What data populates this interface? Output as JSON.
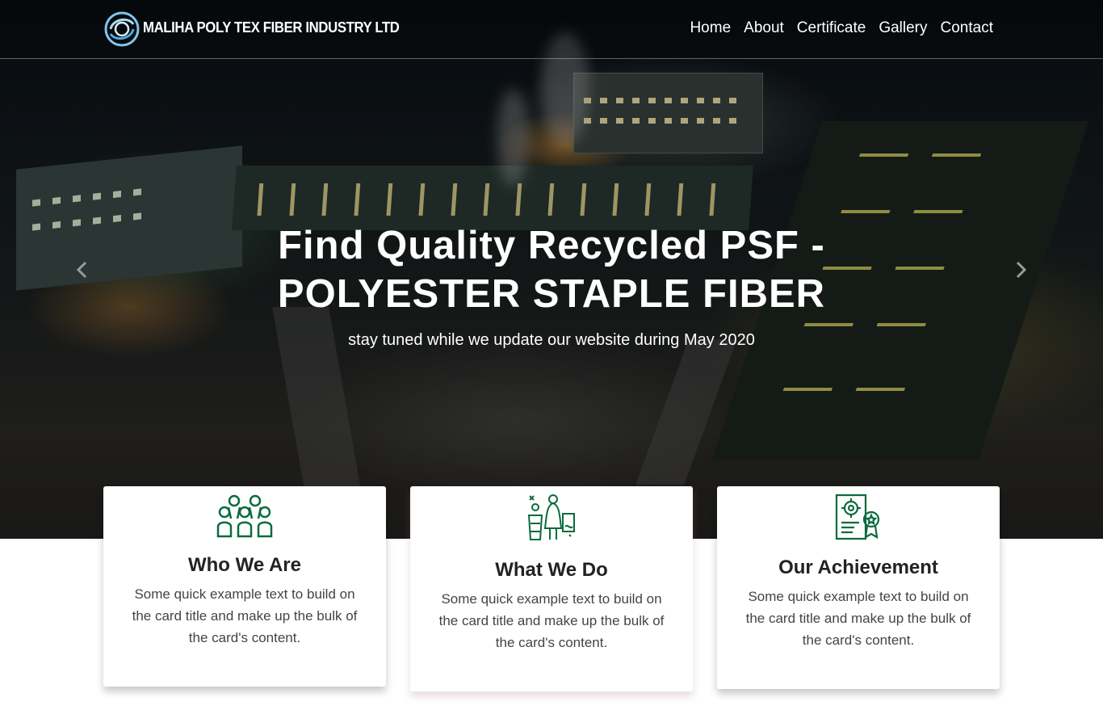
{
  "brand": {
    "name": "MALIHA POLY TEX FIBER INDUSTRY LTD",
    "logo_icon": "swirl-logo-icon"
  },
  "nav": {
    "items": [
      "Home",
      "About",
      "Certificate",
      "Gallery",
      "Contact"
    ]
  },
  "hero": {
    "title": "Find Quality Recycled PSF - POLYESTER STAPLE FIBER",
    "subtitle": "stay tuned while we update our website during May 2020",
    "prev_icon": "chevron-left-icon",
    "next_icon": "chevron-right-icon"
  },
  "cards": [
    {
      "icon": "team-icon",
      "title": "Who We Are",
      "text": "Some quick example text to build on the card title and make up the bulk of the card's content."
    },
    {
      "icon": "worker-icon",
      "title": "What We Do",
      "text": "Some quick example text to build on the card title and make up the bulk of the card's content."
    },
    {
      "icon": "certificate-icon",
      "title": "Our Achievement",
      "text": "Some quick example text to build on the card title and make up the bulk of the card's content."
    }
  ],
  "colors": {
    "icon_green": "#0b6b3f",
    "card_shadow_tint": "#e8d8dc"
  }
}
